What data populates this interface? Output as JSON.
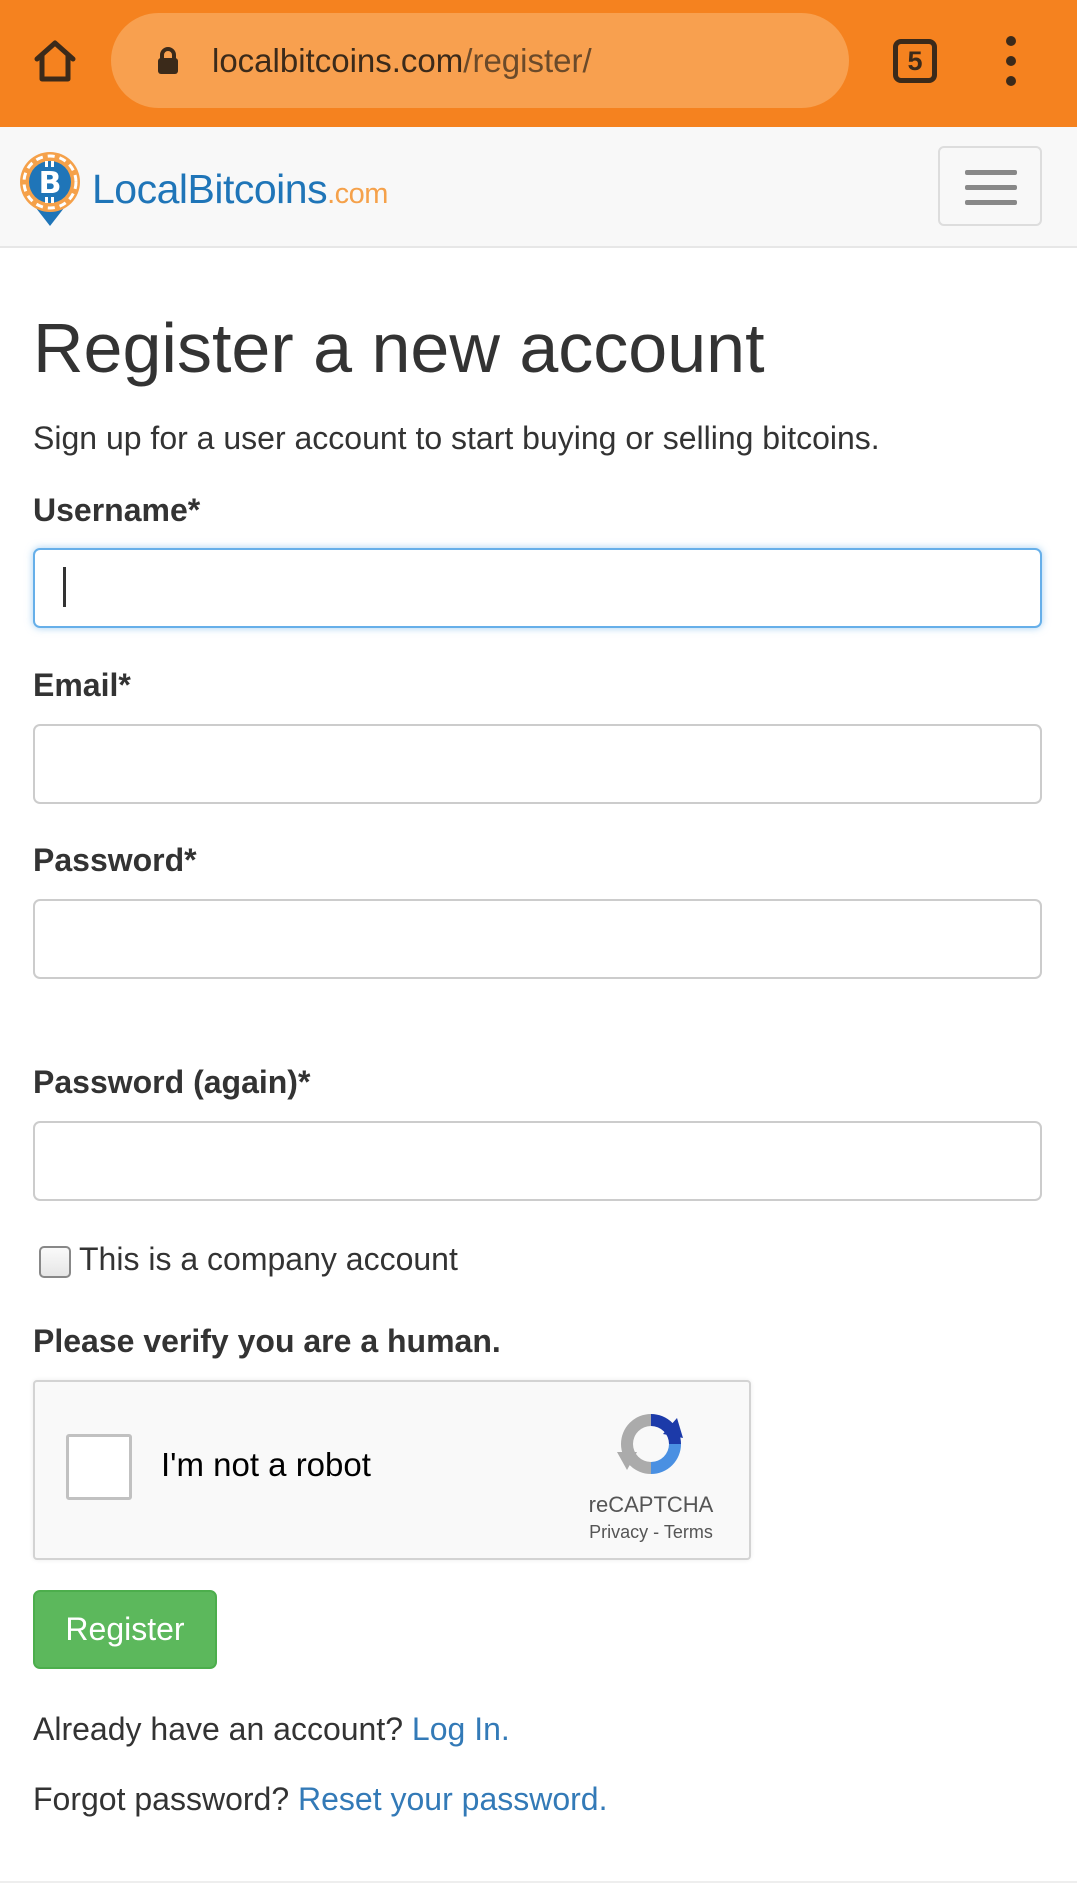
{
  "browser": {
    "url_domain": "localbitcoins.com",
    "url_path": "/register/",
    "tab_count": "5",
    "theme_color": "#f5821f",
    "icons": [
      "home-icon",
      "lock-icon",
      "tabs-icon",
      "more-vert-icon"
    ]
  },
  "site": {
    "logo_name": "LocalBitcoins",
    "logo_tld": ".com",
    "brand_blue": "#1f75b8",
    "brand_orange": "#f5a14a",
    "nav_icon": "hamburger-menu-icon"
  },
  "page": {
    "title": "Register a new account",
    "subtitle": "Sign up for a user account to start buying or selling bitcoins."
  },
  "form": {
    "username_label": "Username*",
    "username_value": "",
    "email_label": "Email*",
    "email_value": "",
    "password_label": "Password*",
    "password_value": "",
    "password_again_label": "Password (again)*",
    "password_again_value": "",
    "company_label": "This is a company account",
    "company_checked": false,
    "verify_label": "Please verify you are a human.",
    "register_label": "Register",
    "register_color": "#5cb85c"
  },
  "recaptcha": {
    "label": "I'm not a robot",
    "brand": "reCAPTCHA",
    "privacy": "Privacy",
    "separator": " - ",
    "terms": "Terms",
    "checked": false
  },
  "footer": {
    "login_prompt": "Already have an account? ",
    "login_link": "Log In.",
    "forgot_prompt": "Forgot password? ",
    "reset_link": "Reset your password.",
    "link_color": "#337ab7"
  }
}
